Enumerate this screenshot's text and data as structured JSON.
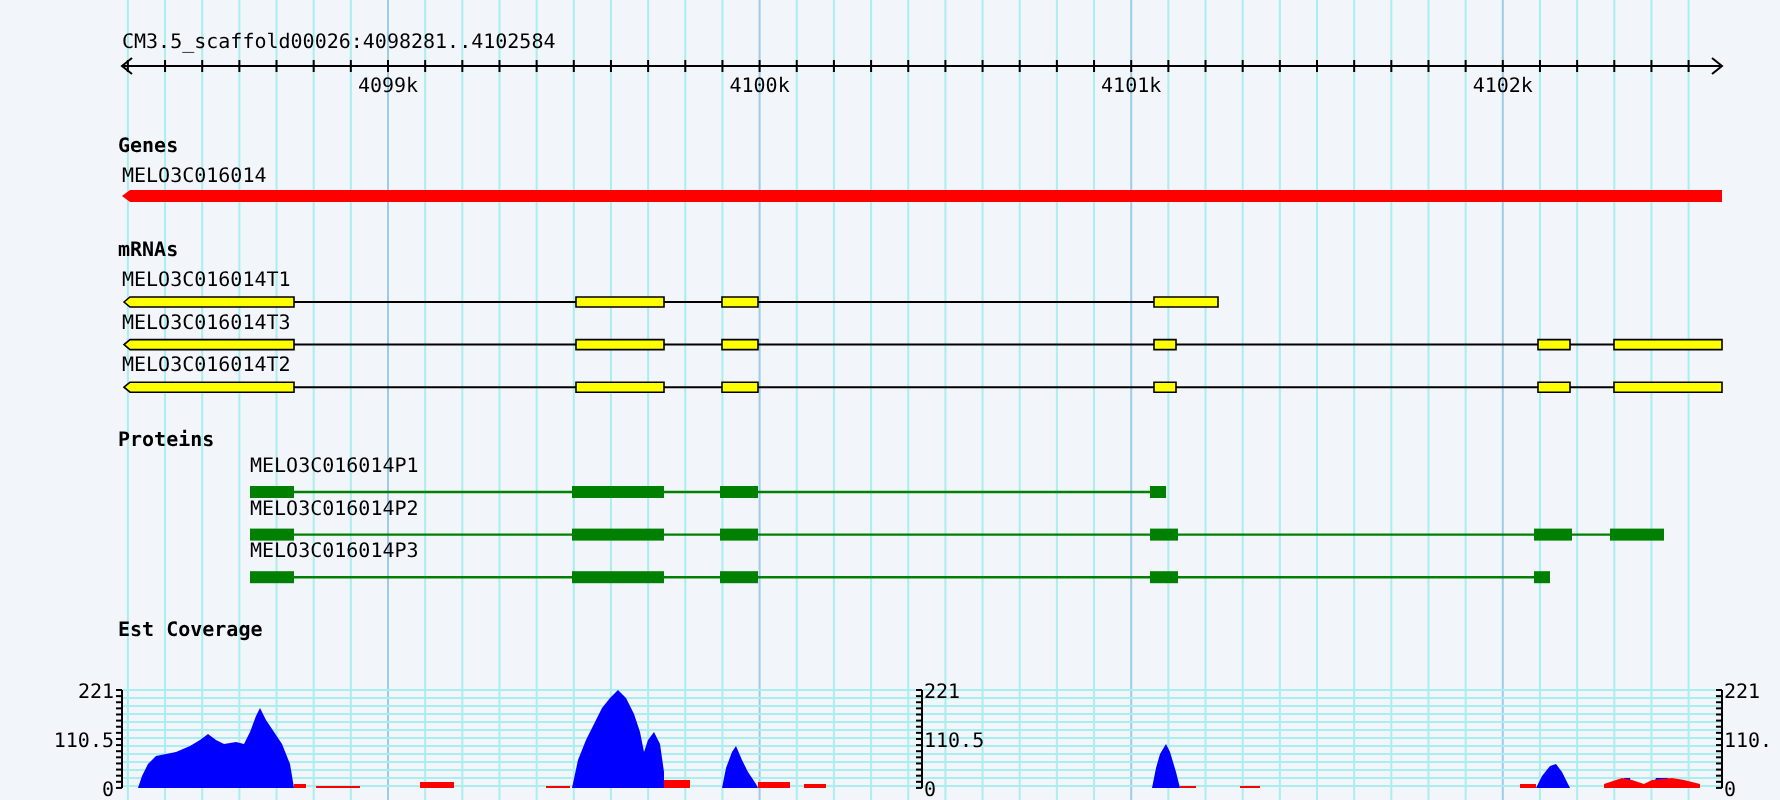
{
  "ruler": {
    "title": "CM3.5_scaffold00026:4098281..4102584",
    "ticks": [
      {
        "label": "4099k"
      },
      {
        "label": "4100k"
      },
      {
        "label": "4101k"
      },
      {
        "label": "4102k"
      }
    ]
  },
  "tracks": [
    {
      "kind": "gene",
      "title": "Genes",
      "features": [
        {
          "name": "MELO3C016014"
        }
      ]
    },
    {
      "kind": "mrna",
      "title": "mRNAs",
      "features": [
        {
          "name": "MELO3C016014T1"
        },
        {
          "name": "MELO3C016014T3"
        },
        {
          "name": "MELO3C016014T2"
        }
      ]
    },
    {
      "kind": "protein",
      "title": "Proteins",
      "features": [
        {
          "name": "MELO3C016014P1"
        },
        {
          "name": "MELO3C016014P2"
        },
        {
          "name": "MELO3C016014P3"
        }
      ]
    },
    {
      "kind": "coverage",
      "title": "Est Coverage",
      "scales": [
        {
          "labels": [
            "221",
            "110.5",
            "0"
          ]
        },
        {
          "labels": [
            "221",
            "110.5",
            "0"
          ]
        },
        {
          "labels": [
            "221",
            "110.",
            "0"
          ]
        }
      ]
    }
  ]
}
